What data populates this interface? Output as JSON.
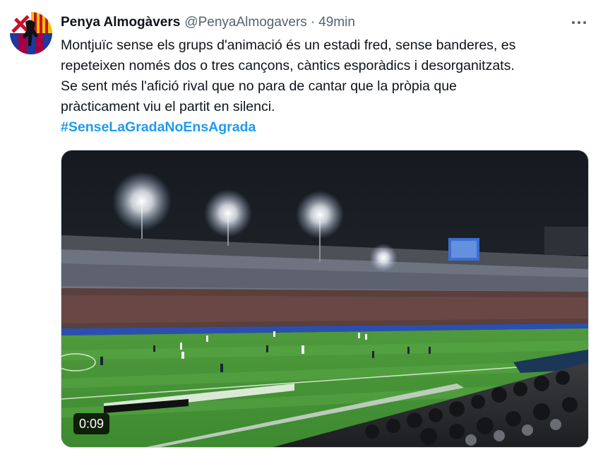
{
  "author": {
    "display_name": "Penya Almogàvers",
    "handle": "@PenyaAlmogavers",
    "separator": "·",
    "time": "49min",
    "avatar_icon": "blaugrana-shield-avatar"
  },
  "more_icon": "more-options-icon",
  "tweet": {
    "lines": [
      "Montjuïc sense els grups d'animació és un estadi fred, sense banderes, es",
      "repeteixen només dos o tres cançons, càntics esporàdics i desorganitzats.",
      "Se sent més l'afició rival que no para de cantar que la pròpia que",
      "pràcticament viu el partit en silenci."
    ],
    "hashtag": "#SenseLaGradaNoEnsAgrada"
  },
  "media": {
    "type": "video",
    "duration": "0:09"
  },
  "colors": {
    "text": "#0f1419",
    "secondary": "#536471",
    "link": "#1d9bf0"
  }
}
